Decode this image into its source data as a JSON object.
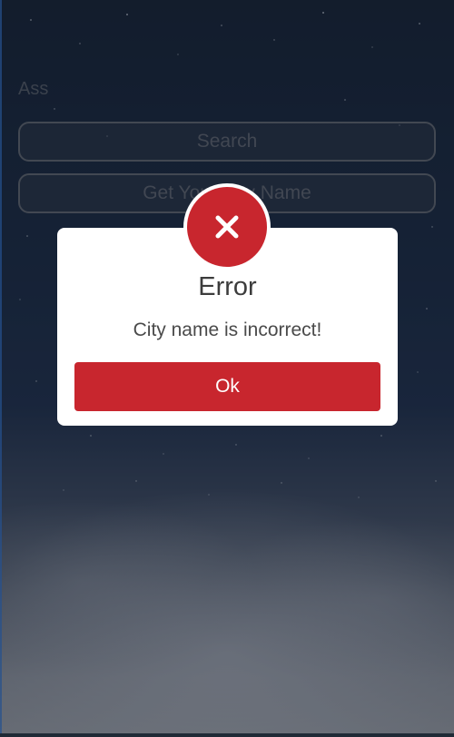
{
  "form": {
    "label": "Ass",
    "search_button": "Search",
    "name_button": "Get Your City Name"
  },
  "dialog": {
    "icon": "close-icon",
    "title": "Error",
    "message": "City name is incorrect!",
    "ok_label": "Ok"
  },
  "colors": {
    "accent_red": "#c8262e",
    "background_dark": "#0d1d33"
  }
}
